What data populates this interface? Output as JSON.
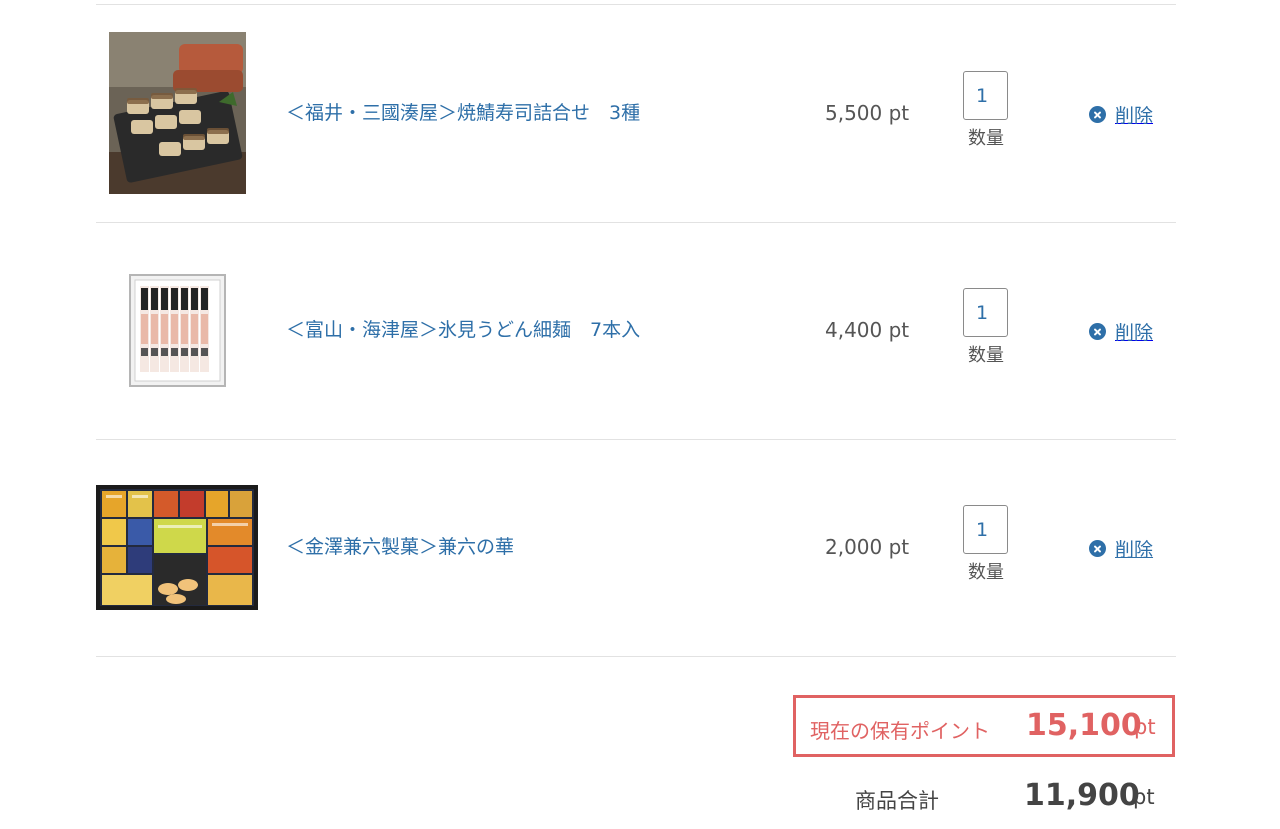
{
  "cart": {
    "items": [
      {
        "name": "＜福井・三國湊屋＞焼鯖寿司詰合せ　3種",
        "price": "5,500 pt",
        "quantity": "1",
        "quantity_label": "数量",
        "delete_label": "削除",
        "image_icon": "grilled-mackerel-sushi-photo"
      },
      {
        "name": "＜富山・海津屋＞氷見うどん細麺　7本入",
        "price": "4,400 pt",
        "quantity": "1",
        "quantity_label": "数量",
        "delete_label": "削除",
        "image_icon": "udon-noodle-box-photo"
      },
      {
        "name": "＜金澤兼六製菓＞兼六の華",
        "price": "2,000 pt",
        "quantity": "1",
        "quantity_label": "数量",
        "delete_label": "削除",
        "image_icon": "rice-cracker-assortment-photo"
      }
    ]
  },
  "summary": {
    "points_label": "現在の保有ポイント",
    "points_value": "15,100",
    "points_unit": "pt",
    "subtotal_label": "商品合計",
    "subtotal_value": "11,900",
    "subtotal_unit": "pt"
  },
  "colors": {
    "link": "#2e6fa8",
    "highlight": "#e06262",
    "text": "#444444",
    "divider": "#e2e2e2"
  }
}
